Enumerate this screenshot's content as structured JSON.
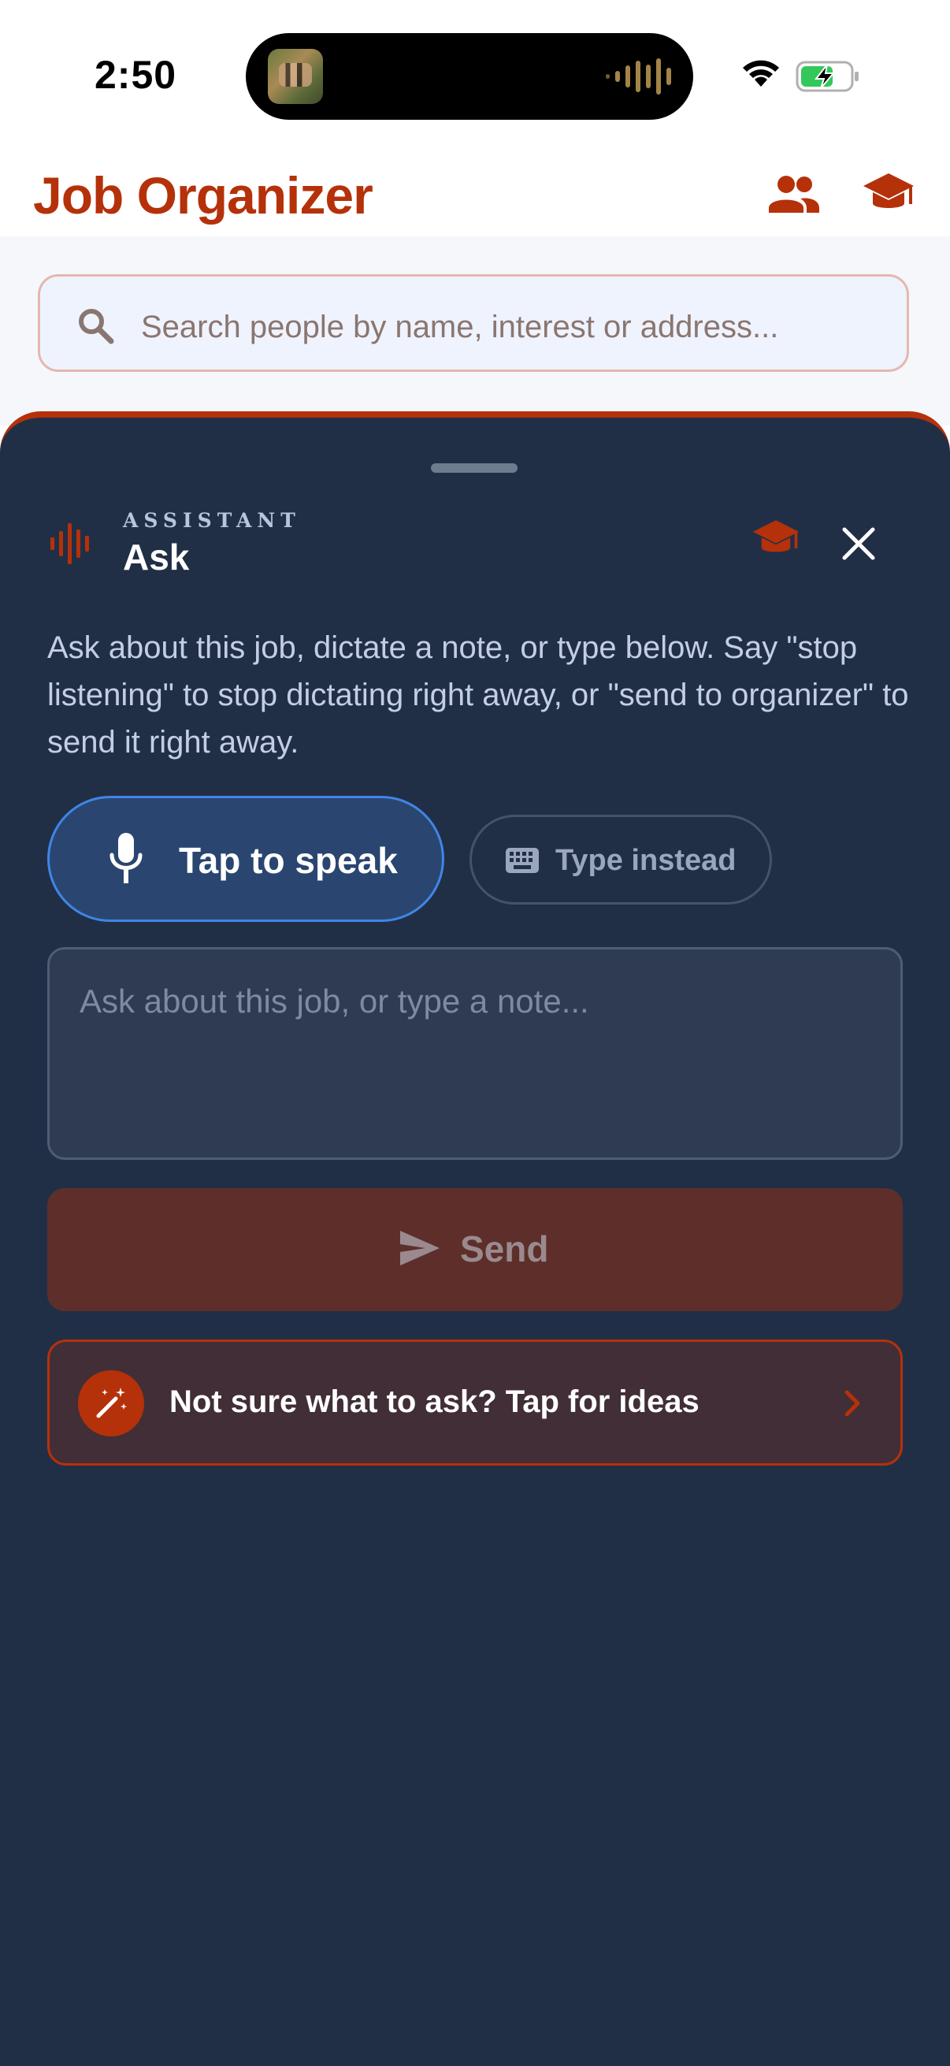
{
  "status_bar": {
    "time": "2:50"
  },
  "header": {
    "title": "Job Organizer",
    "icons": [
      "people-icon",
      "school-icon"
    ]
  },
  "search": {
    "placeholder": "Search people by name, interest or address..."
  },
  "assistant": {
    "caption": "ASSISTANT",
    "title": "Ask",
    "help_text": "Ask about this job, dictate a note, or type below. Say \"stop listening\" to stop dictating right away, or \"send to organizer\" to send it right away.",
    "speak_label": "Tap to speak",
    "type_label": "Type instead",
    "note_placeholder": "Ask about this job, or type a note...",
    "send_label": "Send",
    "ideas_label": "Not sure what to ask? Tap for ideas"
  },
  "colors": {
    "brand": "#b5310a",
    "sheet_bg": "#212f46",
    "speak_border": "#3f86e6",
    "send_bg": "#5e2f2a"
  }
}
